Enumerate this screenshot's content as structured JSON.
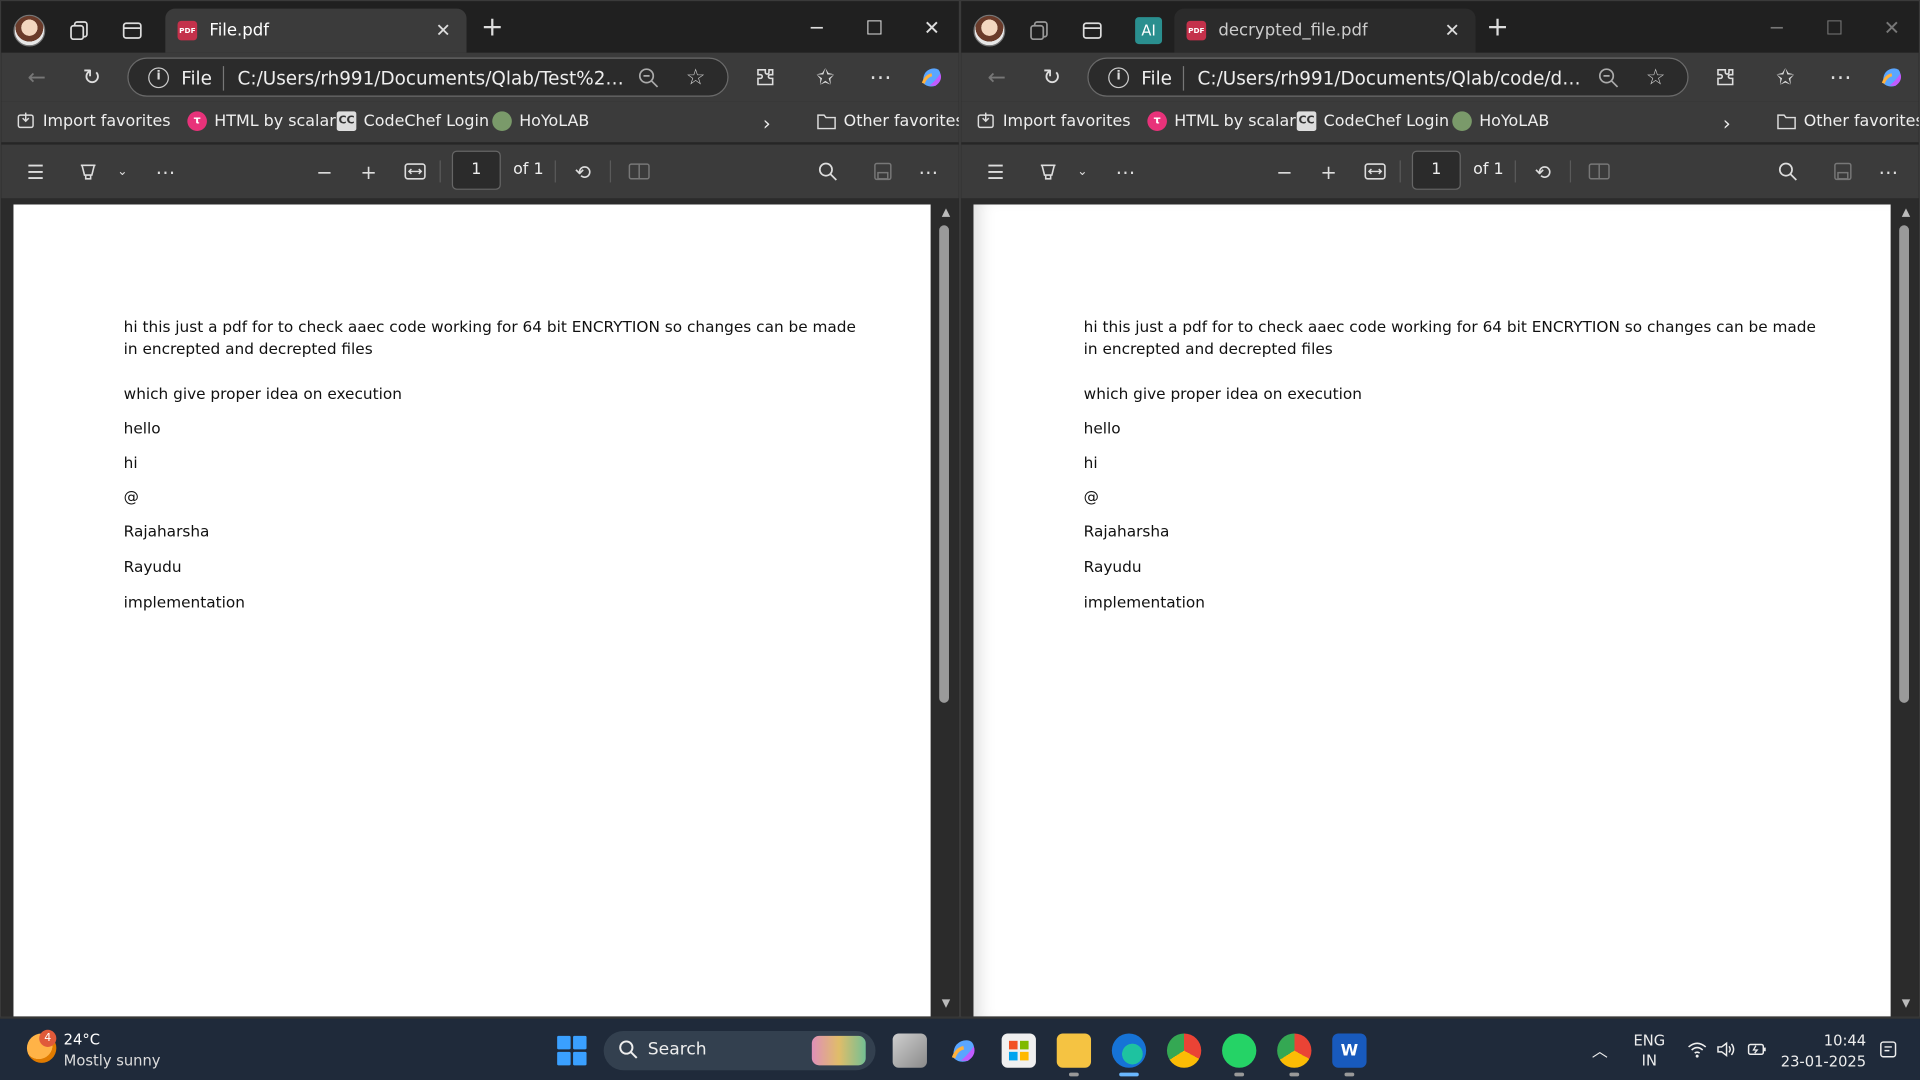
{
  "windows": {
    "left": {
      "tab_title": "File.pdf",
      "omnibox": {
        "scheme": "File",
        "url": "C:/Users/rh991/Documents/Qlab/Test%20Files/..."
      },
      "page_number": "1",
      "page_total": "of 1"
    },
    "right": {
      "ai_badge": "AI",
      "tab_title": "decrypted_file.pdf",
      "omnibox": {
        "scheme": "File",
        "url": "C:/Users/rh991/Documents/Qlab/code/decrypt..."
      },
      "page_number": "1",
      "page_total": "of 1"
    }
  },
  "favorites": {
    "import": "Import favorites",
    "html_scalar": "HTML by scalar",
    "codechef": "CodeChef Login",
    "codechef_icon": "CC",
    "hoyolab": "HoYoLAB",
    "other": "Other favorites"
  },
  "document": {
    "lines": [
      "hi this just a pdf for to check aaec code working for 64 bit ENCRYTION so changes can be made",
      "in encrepted and decrepted files",
      "which give proper idea on execution",
      "hello",
      "hi",
      "@",
      "Rajaharsha",
      "Rayudu",
      "implementation"
    ]
  },
  "taskbar": {
    "weather": {
      "badge": "4",
      "temp": "24°C",
      "desc": "Mostly sunny"
    },
    "search": "Search",
    "word_letter": "W",
    "lang": [
      "ENG",
      "IN"
    ],
    "time": "10:44",
    "date": "23-01-2025"
  },
  "colors": {
    "chrome_dark": "#202020",
    "toolbar": "#3b3b3b",
    "taskbar": "#1f2a3a",
    "accent": "#3aa0ff"
  }
}
